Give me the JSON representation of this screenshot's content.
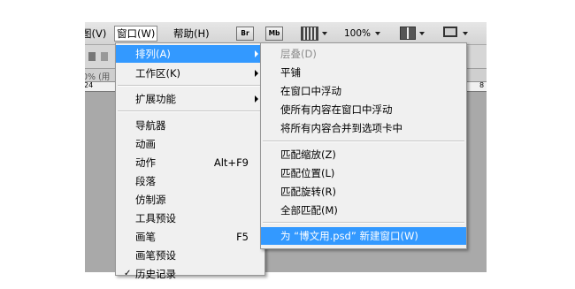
{
  "menubar": {
    "items": [
      {
        "label": "图(V)"
      },
      {
        "label": "窗口(W)"
      },
      {
        "label": "帮助(H)"
      }
    ],
    "toolbar": {
      "br_label": "Br",
      "mb_label": "Mb",
      "zoom": "100%"
    }
  },
  "docbar": {
    "label": "0% (用"
  },
  "ruler": {
    "left_tick": "24",
    "right_tick": "8"
  },
  "window_menu": {
    "items": [
      {
        "label": "排列(A)"
      },
      {
        "label": "工作区(K)"
      },
      {
        "label": "扩展功能"
      },
      {
        "label": "导航器"
      },
      {
        "label": "动画"
      },
      {
        "label": "动作",
        "shortcut": "Alt+F9"
      },
      {
        "label": "段落"
      },
      {
        "label": "仿制源"
      },
      {
        "label": "工具预设"
      },
      {
        "label": "画笔",
        "shortcut": "F5"
      },
      {
        "label": "画笔预设"
      },
      {
        "label": "历史记录"
      }
    ]
  },
  "arrange_submenu": {
    "items": [
      {
        "label": "层叠(D)"
      },
      {
        "label": "平铺"
      },
      {
        "label": "在窗口中浮动"
      },
      {
        "label": "使所有内容在窗口中浮动"
      },
      {
        "label": "将所有内容合并到选项卡中"
      },
      {
        "label": "匹配缩放(Z)"
      },
      {
        "label": "匹配位置(L)"
      },
      {
        "label": "匹配旋转(R)"
      },
      {
        "label": "全部匹配(M)"
      },
      {
        "label": "为 “博文用.psd” 新建窗口(W)"
      }
    ]
  },
  "colors": {
    "highlight": "#3399ff",
    "menu_bg": "#f0f0f0",
    "workspace_bg": "#a9a9a9"
  }
}
